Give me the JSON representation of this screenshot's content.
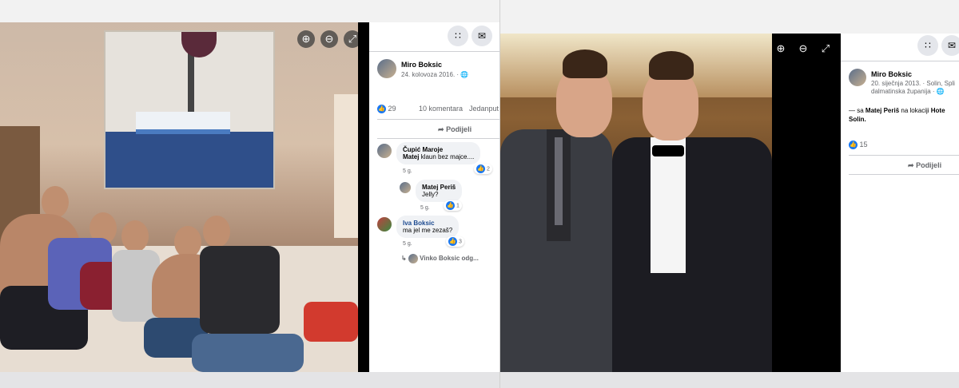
{
  "left_post": {
    "author": "Miro Boksic",
    "date": "24. kolovoza 2016. ·",
    "likes": "29",
    "comments": "10 komentara",
    "shares": "Jedanput",
    "share_label": "Podijeli",
    "comments_list": [
      {
        "author": "Čupić Maroje",
        "mention": "Matej",
        "text": "klaun bez majce....",
        "time": "5 g.",
        "reactions": "2"
      },
      {
        "author": "Matej Periš",
        "text": "Jelly?",
        "time": "5 g.",
        "reactions": "1"
      },
      {
        "author": "Iva Boksic",
        "text": "ma jel me zezaš?",
        "time": "5 g.",
        "reactions": "3"
      }
    ],
    "reply_preview": "Vinko Boksic odg..."
  },
  "right_post": {
    "author": "Miro Boksic",
    "date": "20. siječnja 2013. · Solin, Spli",
    "location_line2": "dalmatinska županija ·",
    "caption_prefix": "— sa",
    "caption_name": "Matej Periš",
    "caption_mid": "na lokaciji",
    "caption_place": "Hote",
    "caption_place2": "Solin.",
    "likes": "15",
    "share_label": "Podijeli"
  },
  "icons": {
    "zoom_in": "zoom-in-icon",
    "zoom_out": "zoom-out-icon",
    "fullscreen": "fullscreen-icon",
    "menu": "grid-menu-icon",
    "messenger": "messenger-icon",
    "like": "like-icon",
    "share": "share-icon"
  },
  "colors": {
    "accent": "#1877f2",
    "meta": "#65676b"
  }
}
